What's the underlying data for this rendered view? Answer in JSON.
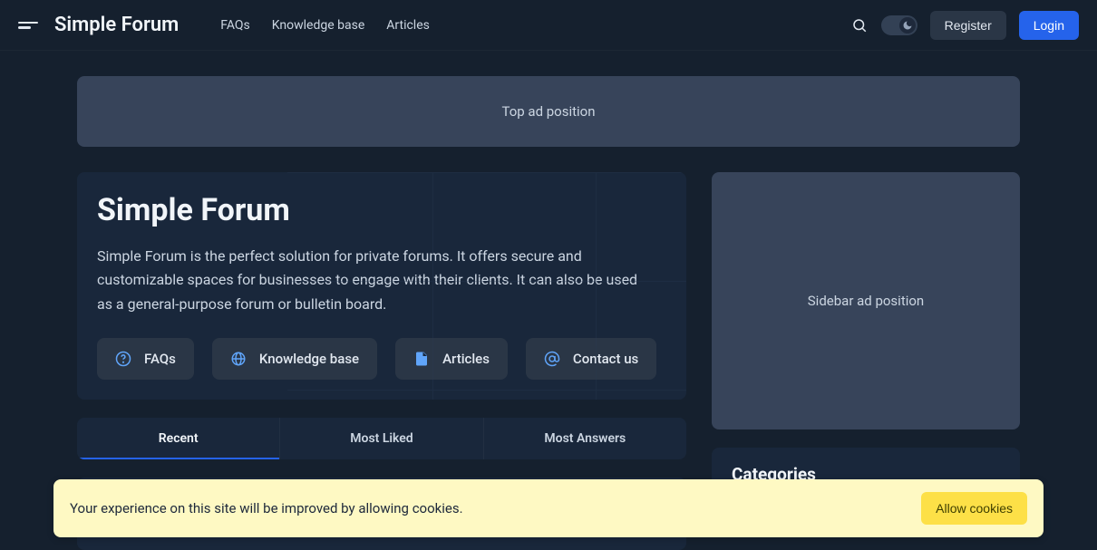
{
  "brand": "Simple Forum",
  "nav": {
    "links": [
      "FAQs",
      "Knowledge base",
      "Articles"
    ],
    "register": "Register",
    "login": "Login"
  },
  "ads": {
    "top": "Top ad position",
    "sidebar": "Sidebar ad position"
  },
  "hero": {
    "title": "Simple Forum",
    "description": "Simple Forum is the perfect solution for private forums. It offers secure and customizable spaces for businesses to engage with their clients. It can also be used as a general-purpose forum or bulletin board.",
    "pills": {
      "faqs": "FAQs",
      "kb": "Knowledge base",
      "articles": "Articles",
      "contact": "Contact us"
    }
  },
  "tabs": {
    "recent": "Recent",
    "liked": "Most Liked",
    "answers": "Most Answers"
  },
  "sidebar": {
    "categories_title": "Categories"
  },
  "cookie": {
    "text": "Your experience on this site will be improved by allowing cookies.",
    "button": "Allow cookies"
  }
}
